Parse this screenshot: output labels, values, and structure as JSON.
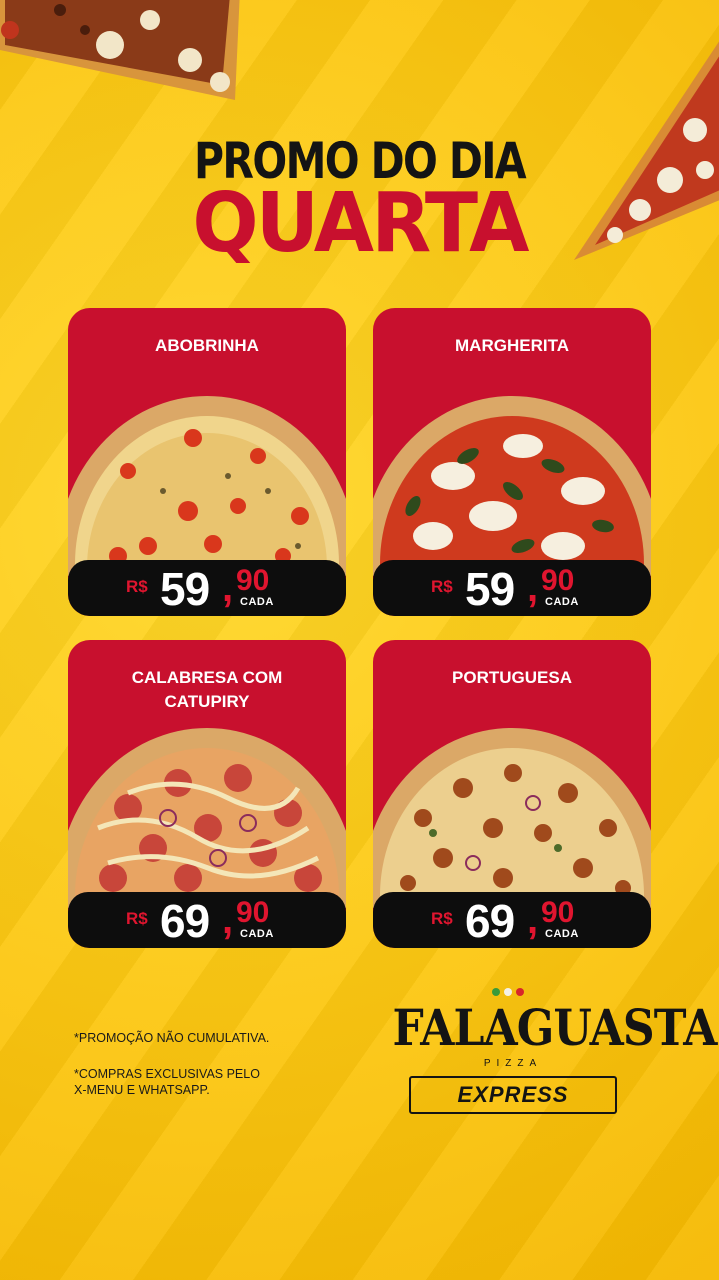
{
  "title": {
    "line1_part1": "PROMO",
    "line1_part2": "DO DIA",
    "line2": "QUARTA"
  },
  "cards": [
    {
      "name": "ABOBRINHA",
      "currency": "R$",
      "price_int": "59",
      "price_dec": "90",
      "unit": "CADA"
    },
    {
      "name": "MARGHERITA",
      "currency": "R$",
      "price_int": "59",
      "price_dec": "90",
      "unit": "CADA"
    },
    {
      "name": "CALABRESA COM CATUPIRY",
      "currency": "R$",
      "price_int": "69",
      "price_dec": "90",
      "unit": "CADA"
    },
    {
      "name": "PORTUGUESA",
      "currency": "R$",
      "price_int": "69",
      "price_dec": "90",
      "unit": "CADA"
    }
  ],
  "notes": {
    "note1": "*PROMOÇÃO NÃO CUMULATIVA.",
    "note2_line1": "*COMPRAS EXCLUSIVAS PELO",
    "note2_line2": "X-MENU E WHATSAPP."
  },
  "logo": {
    "name": "FALAGUASTA",
    "subtitle": "PIZZA",
    "express": "EXPRESS"
  },
  "colors": {
    "background": "#fcc712",
    "card": "#c8102e",
    "price_bar": "#0d0d0d",
    "accent_red": "#e0152f"
  }
}
